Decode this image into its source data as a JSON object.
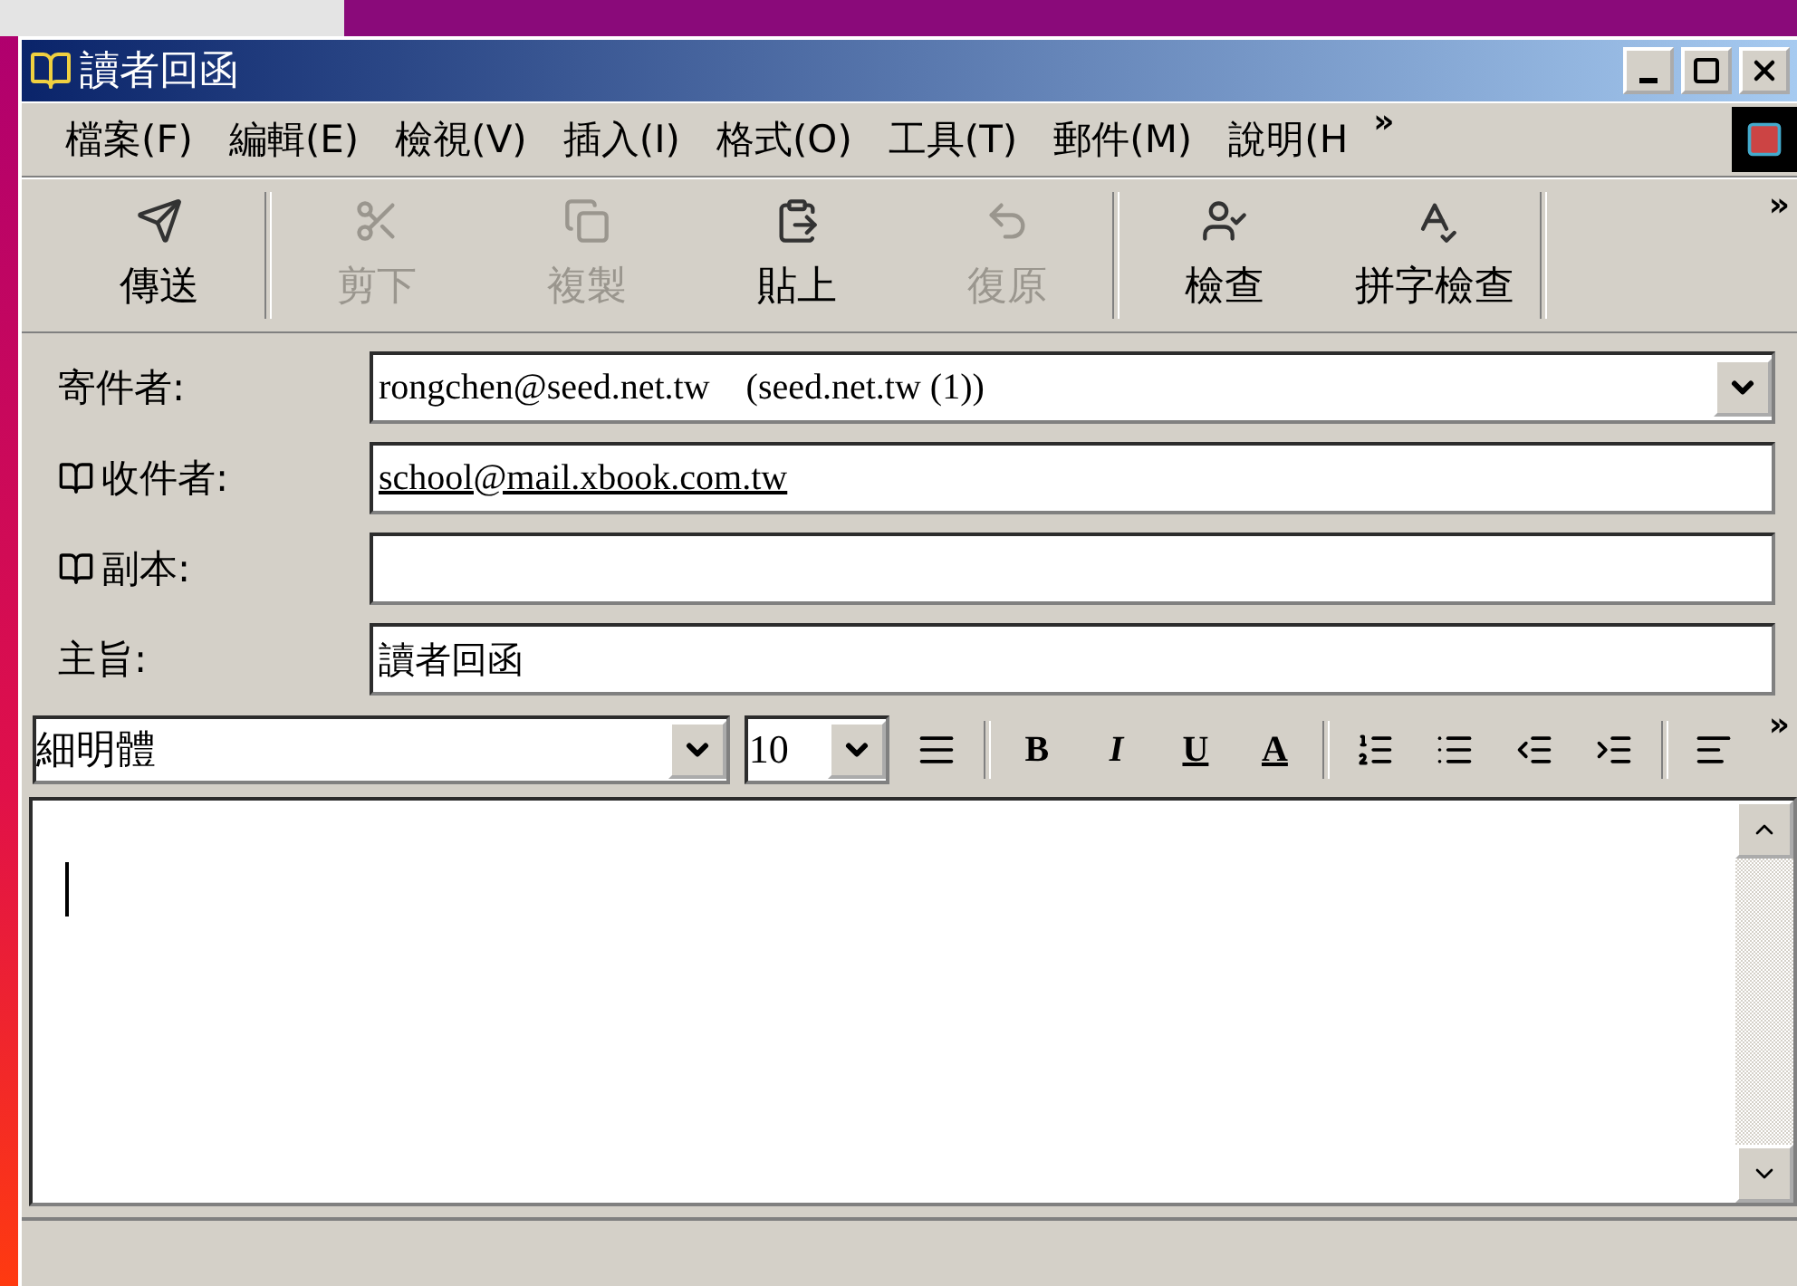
{
  "window": {
    "title": "讀者回函"
  },
  "menu": [
    {
      "label": "檔案(F)"
    },
    {
      "label": "編輯(E)"
    },
    {
      "label": "檢視(V)"
    },
    {
      "label": "插入(I)"
    },
    {
      "label": "格式(O)"
    },
    {
      "label": "工具(T)"
    },
    {
      "label": "郵件(M)"
    },
    {
      "label": "說明(H"
    }
  ],
  "menu_overflow": "»",
  "toolbar": [
    {
      "label": "傳送",
      "kind": "send",
      "disabled": false
    },
    {
      "label": "剪下",
      "kind": "cut",
      "disabled": true
    },
    {
      "label": "複製",
      "kind": "copy",
      "disabled": true
    },
    {
      "label": "貼上",
      "kind": "paste",
      "disabled": false
    },
    {
      "label": "復原",
      "kind": "undo",
      "disabled": true
    },
    {
      "label": "檢查",
      "kind": "check",
      "disabled": false
    },
    {
      "label": "拼字檢查",
      "kind": "spell",
      "disabled": false
    }
  ],
  "toolbar_overflow": "»",
  "fields": [
    {
      "label": "寄件者:",
      "kind": "dropdown",
      "address_book": false,
      "value": "rongchen@seed.net.tw    (seed.net.tw (1))"
    },
    {
      "label": "收件者:",
      "kind": "text",
      "address_book": true,
      "underlined": true,
      "value": "school@mail.xbook.com.tw"
    },
    {
      "label": "副本:",
      "kind": "text",
      "address_book": true
    },
    {
      "label": "主旨:",
      "kind": "text",
      "address_book": false,
      "value": "讀者回函"
    }
  ],
  "format": {
    "font": "細明體",
    "size": "10",
    "buttons": [
      {
        "kind": "style"
      },
      {
        "kind": "bold",
        "label": "B"
      },
      {
        "kind": "italic",
        "label": "I"
      },
      {
        "kind": "underline",
        "label": "U"
      },
      {
        "kind": "color",
        "label": "A"
      },
      {
        "kind": "numbered"
      },
      {
        "kind": "bullets"
      },
      {
        "kind": "outdent"
      },
      {
        "kind": "indent"
      },
      {
        "kind": "align"
      }
    ],
    "overflow": "»"
  }
}
